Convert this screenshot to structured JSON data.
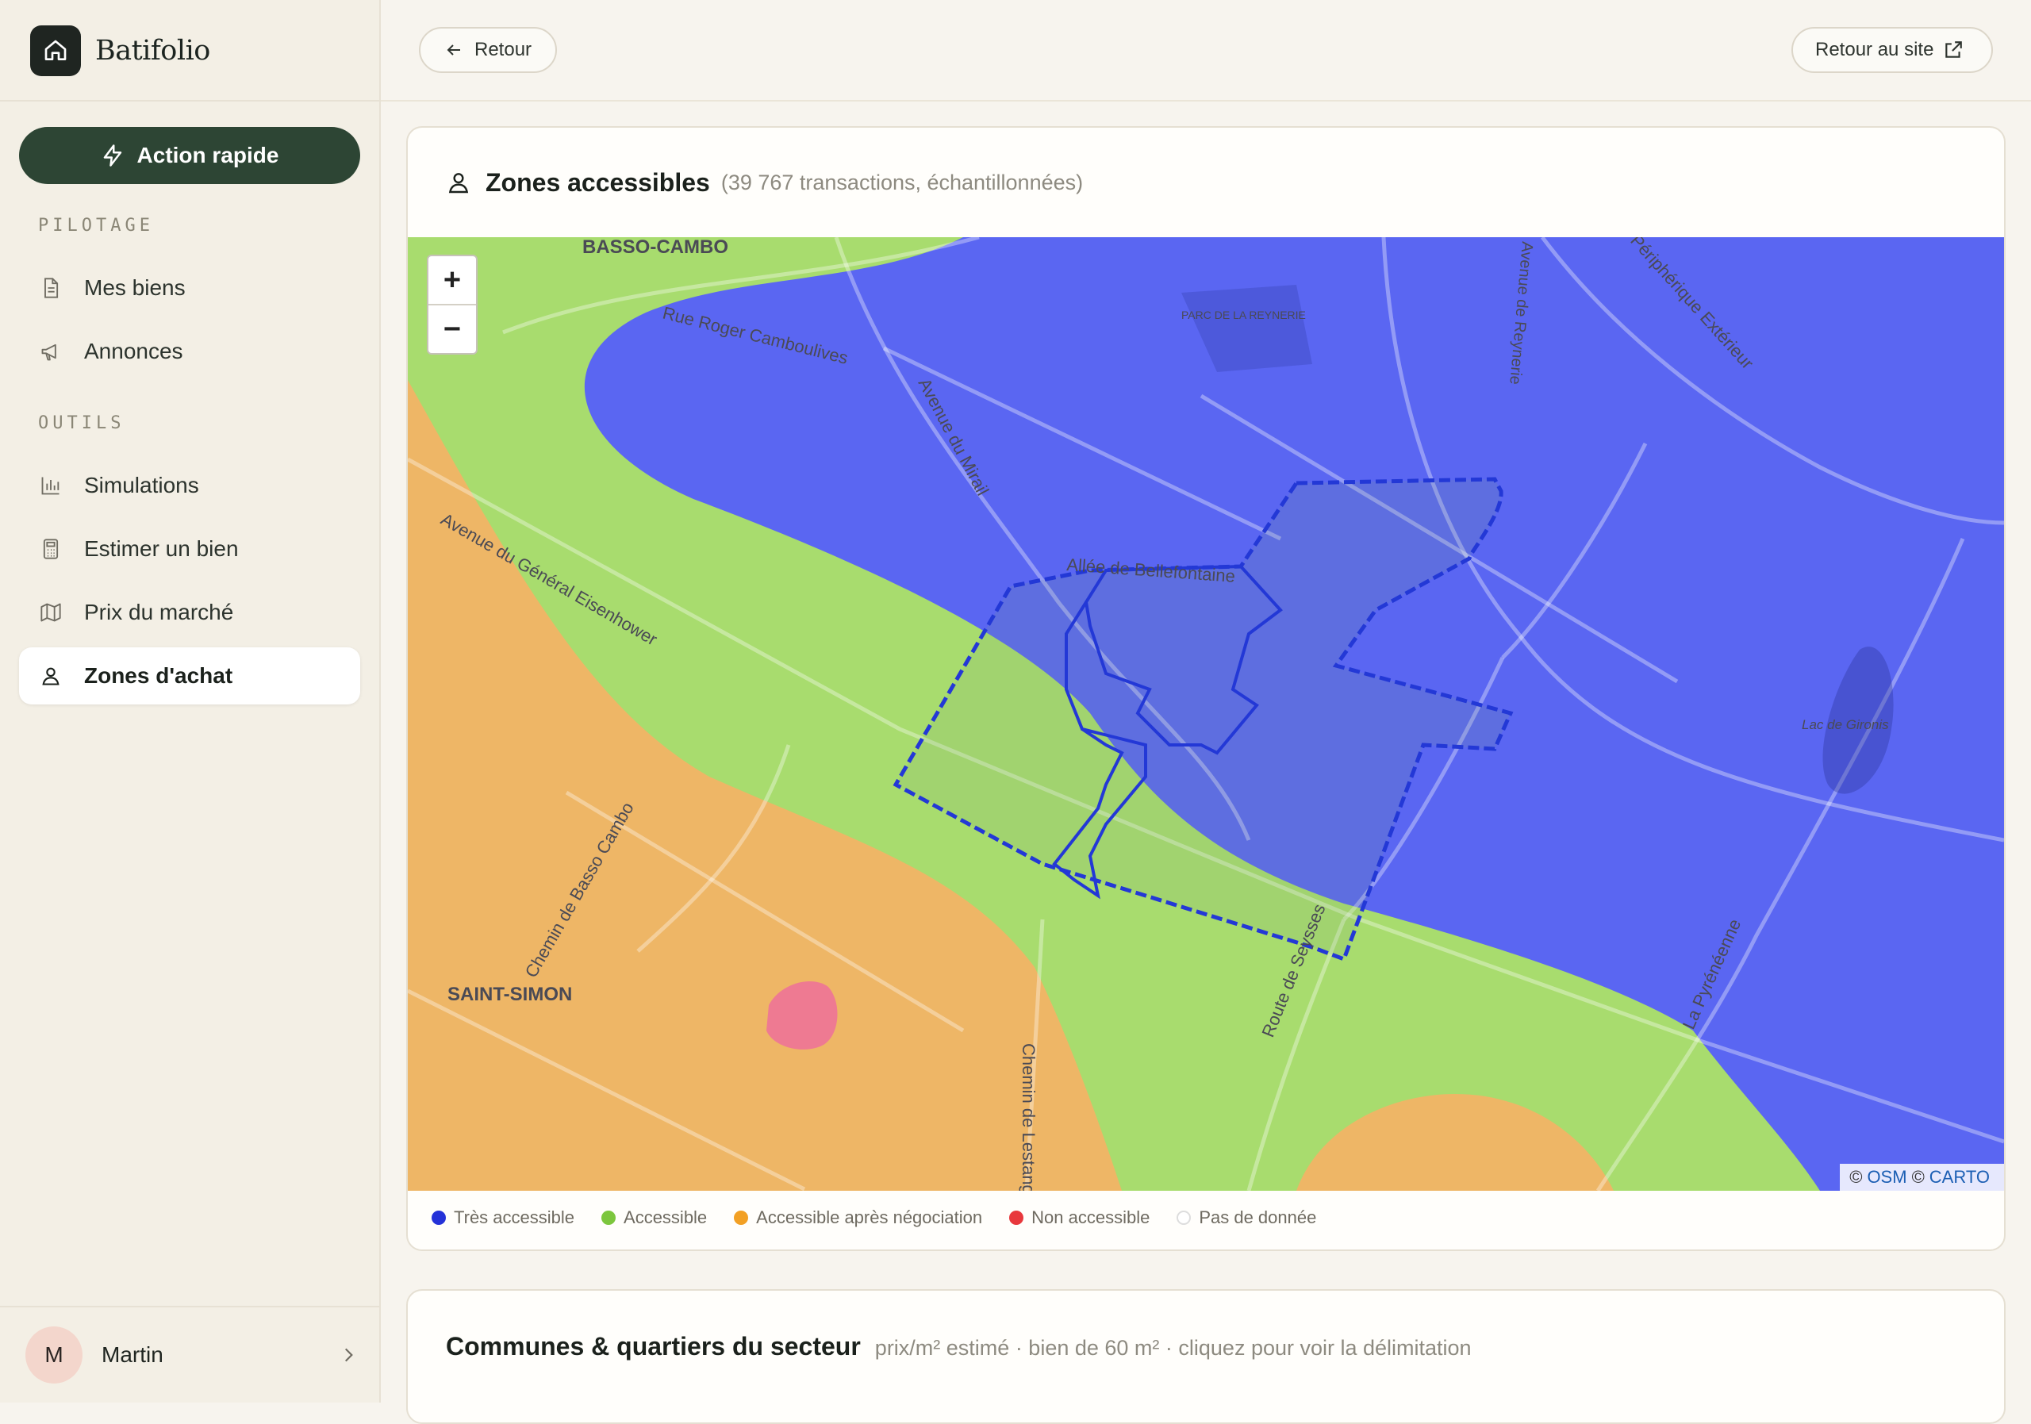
{
  "brand": {
    "name": "Batifolio",
    "icon": "home-icon"
  },
  "sidebar": {
    "quick_action": "Action rapide",
    "sections": [
      {
        "label": "PILOTAGE",
        "items": [
          {
            "label": "Mes biens",
            "icon": "document-icon"
          },
          {
            "label": "Annonces",
            "icon": "megaphone-icon"
          }
        ]
      },
      {
        "label": "OUTILS",
        "items": [
          {
            "label": "Simulations",
            "icon": "bar-chart-icon"
          },
          {
            "label": "Estimer un bien",
            "icon": "calculator-icon"
          },
          {
            "label": "Prix du marché",
            "icon": "map-icon"
          },
          {
            "label": "Zones d'achat",
            "icon": "map-pin-user-icon",
            "active": true
          }
        ]
      }
    ],
    "user": {
      "initial": "M",
      "name": "Martin"
    }
  },
  "topbar": {
    "back": "Retour",
    "site": "Retour au site"
  },
  "map_card": {
    "title": "Zones accessibles",
    "subtitle": "(39 767 transactions, échantillonnées)",
    "map": {
      "labels": [
        "BASSO-CAMBO",
        "SAINT-SIMON",
        "PARC DE LA REYNERIE",
        "Lac de Gironis",
        "Rue Roger Camboulives",
        "Avenue du Mirail",
        "Avenue du Général Eisenhower",
        "Allée de Bellefontaine",
        "Route de Seysses",
        "Chemin de Basso Cambo",
        "Chemin de Lestang",
        "La Pyrénéenne",
        "Périphérique Extérieur",
        "Avenue de Reynerie"
      ],
      "zoom_in": "+",
      "zoom_out": "−",
      "attribution": {
        "prefix": "©",
        "osm": "OSM",
        "carto": "CARTO"
      },
      "zone_colors": {
        "tres_accessible": "#5a66f2",
        "accessible": "#a8dc6e",
        "negociation": "#eeb666",
        "non_accessible": "#ee7a92"
      }
    },
    "legend": [
      {
        "label": "Très accessible",
        "color": "#2432d8"
      },
      {
        "label": "Accessible",
        "color": "#7cc63d"
      },
      {
        "label": "Accessible après négociation",
        "color": "#f2a024"
      },
      {
        "label": "Non accessible",
        "color": "#e8383c"
      },
      {
        "label": "Pas de donnée",
        "color": "#ffffff"
      }
    ]
  },
  "communes_card": {
    "title": "Communes & quartiers du secteur",
    "subtitle": "prix/m² estimé · bien de 60 m² · cliquez pour voir la délimitation"
  }
}
